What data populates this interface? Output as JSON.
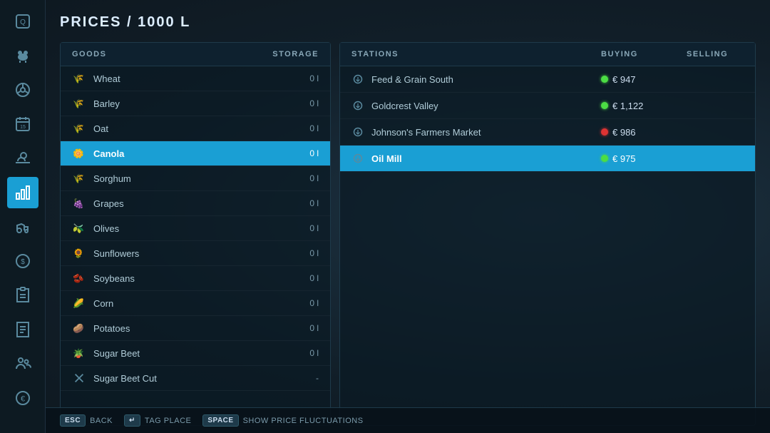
{
  "page": {
    "title": "PRICES / 1000 L"
  },
  "sidebar": {
    "items": [
      {
        "id": "q-icon",
        "icon": "Q",
        "active": false,
        "label": "Q"
      },
      {
        "id": "livestock-icon",
        "icon": "🐄",
        "active": false,
        "label": "livestock"
      },
      {
        "id": "steering-icon",
        "icon": "🎮",
        "active": false,
        "label": "steering"
      },
      {
        "id": "calendar-icon",
        "icon": "📅",
        "active": false,
        "label": "calendar"
      },
      {
        "id": "weather-icon",
        "icon": "🌤",
        "active": false,
        "label": "weather"
      },
      {
        "id": "stats-icon",
        "icon": "📊",
        "active": true,
        "label": "statistics"
      },
      {
        "id": "tractor-icon",
        "icon": "🚜",
        "active": false,
        "label": "vehicles"
      },
      {
        "id": "money-icon",
        "icon": "💰",
        "active": false,
        "label": "finances"
      },
      {
        "id": "contract-icon",
        "icon": "🔧",
        "active": false,
        "label": "contracts"
      },
      {
        "id": "notebook-icon",
        "icon": "📋",
        "active": false,
        "label": "notebook"
      },
      {
        "id": "multiplayer-icon",
        "icon": "👥",
        "active": false,
        "label": "multiplayer"
      },
      {
        "id": "euro-icon",
        "icon": "€",
        "active": false,
        "label": "euro"
      }
    ]
  },
  "goods_panel": {
    "col_goods": "GOODS",
    "col_storage": "STORAGE",
    "items": [
      {
        "name": "Wheat",
        "icon": "🌾",
        "storage": "0 l",
        "selected": false
      },
      {
        "name": "Barley",
        "icon": "🌾",
        "storage": "0 l",
        "selected": false
      },
      {
        "name": "Oat",
        "icon": "🌾",
        "storage": "0 l",
        "selected": false
      },
      {
        "name": "Canola",
        "icon": "🌻",
        "storage": "0 l",
        "selected": true
      },
      {
        "name": "Sorghum",
        "icon": "🌾",
        "storage": "0 l",
        "selected": false
      },
      {
        "name": "Grapes",
        "icon": "🍇",
        "storage": "0 l",
        "selected": false
      },
      {
        "name": "Olives",
        "icon": "🫒",
        "storage": "0 l",
        "selected": false
      },
      {
        "name": "Sunflowers",
        "icon": "🌻",
        "storage": "0 l",
        "selected": false
      },
      {
        "name": "Soybeans",
        "icon": "🫘",
        "storage": "0 l",
        "selected": false
      },
      {
        "name": "Corn",
        "icon": "🌽",
        "storage": "0 l",
        "selected": false
      },
      {
        "name": "Potatoes",
        "icon": "🥔",
        "storage": "0 l",
        "selected": false
      },
      {
        "name": "Sugar Beet",
        "icon": "🫚",
        "storage": "0 l",
        "selected": false
      },
      {
        "name": "Sugar Beet Cut",
        "icon": "✂",
        "storage": "-",
        "selected": false
      }
    ]
  },
  "stations_panel": {
    "col_station": "STATIONS",
    "col_buying": "BUYING",
    "col_selling": "SELLING",
    "items": [
      {
        "name": "Feed & Grain South",
        "dot": "green",
        "price": "€ 947",
        "selling": "",
        "selected": false
      },
      {
        "name": "Goldcrest Valley",
        "dot": "green",
        "price": "€ 1,122",
        "selling": "",
        "selected": false
      },
      {
        "name": "Johnson's Farmers Market",
        "dot": "red",
        "price": "€ 986",
        "selling": "",
        "selected": false
      },
      {
        "name": "Oil Mill",
        "dot": "green",
        "price": "€ 975",
        "selling": "",
        "selected": true
      }
    ]
  },
  "bottom_bar": {
    "esc_label": "ESC",
    "esc_action": "BACK",
    "tag_label": "↵",
    "tag_action": "TAG PLACE",
    "space_label": "SPACE",
    "space_action": "SHOW PRICE FLUCTUATIONS"
  }
}
